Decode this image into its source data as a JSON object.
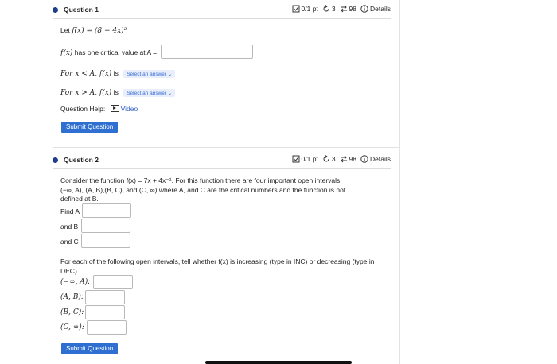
{
  "q1": {
    "title": "Question 1",
    "points": "0/1 pt",
    "retries": "3",
    "attempts": "98",
    "details": "Details",
    "intro_prefix": "Let ",
    "intro_math": "f(x) = (8 − 4x)²",
    "critical_prefix": "f(x)",
    "critical_text": " has one critical value at A = ",
    "critical_value": "",
    "line1_math": "For x < A, f(x)",
    "line1_is": " is ",
    "line2_math": "For x > A, f(x)",
    "line2_is": " is ",
    "select_label": "Select an answer ⌄",
    "help_label": "Question Help:",
    "video_label": "Video",
    "submit": "Submit Question"
  },
  "q2": {
    "title": "Question 2",
    "points": "0/1 pt",
    "retries": "3",
    "attempts": "98",
    "details": "Details",
    "desc1": "Consider the function f(x) = 7x + 4x⁻¹. For this function there are four important open intervals:",
    "desc2": "(−∞, A), (A, B),(B, C), and (C, ∞) where A, and C are the critical numbers and the function is not",
    "desc3": "defined at B.",
    "find_a": "Find A",
    "and_b": "and B",
    "and_c": "and C",
    "inc_desc1": "For each of the following open intervals, tell whether f(x) is increasing (type in INC) or decreasing (type in",
    "inc_desc2": "DEC).",
    "int1": "(−∞, A):",
    "int2": "(A, B):",
    "int3": "(B, C):",
    "int4": "(C, ∞):",
    "submit": "Submit Question"
  }
}
